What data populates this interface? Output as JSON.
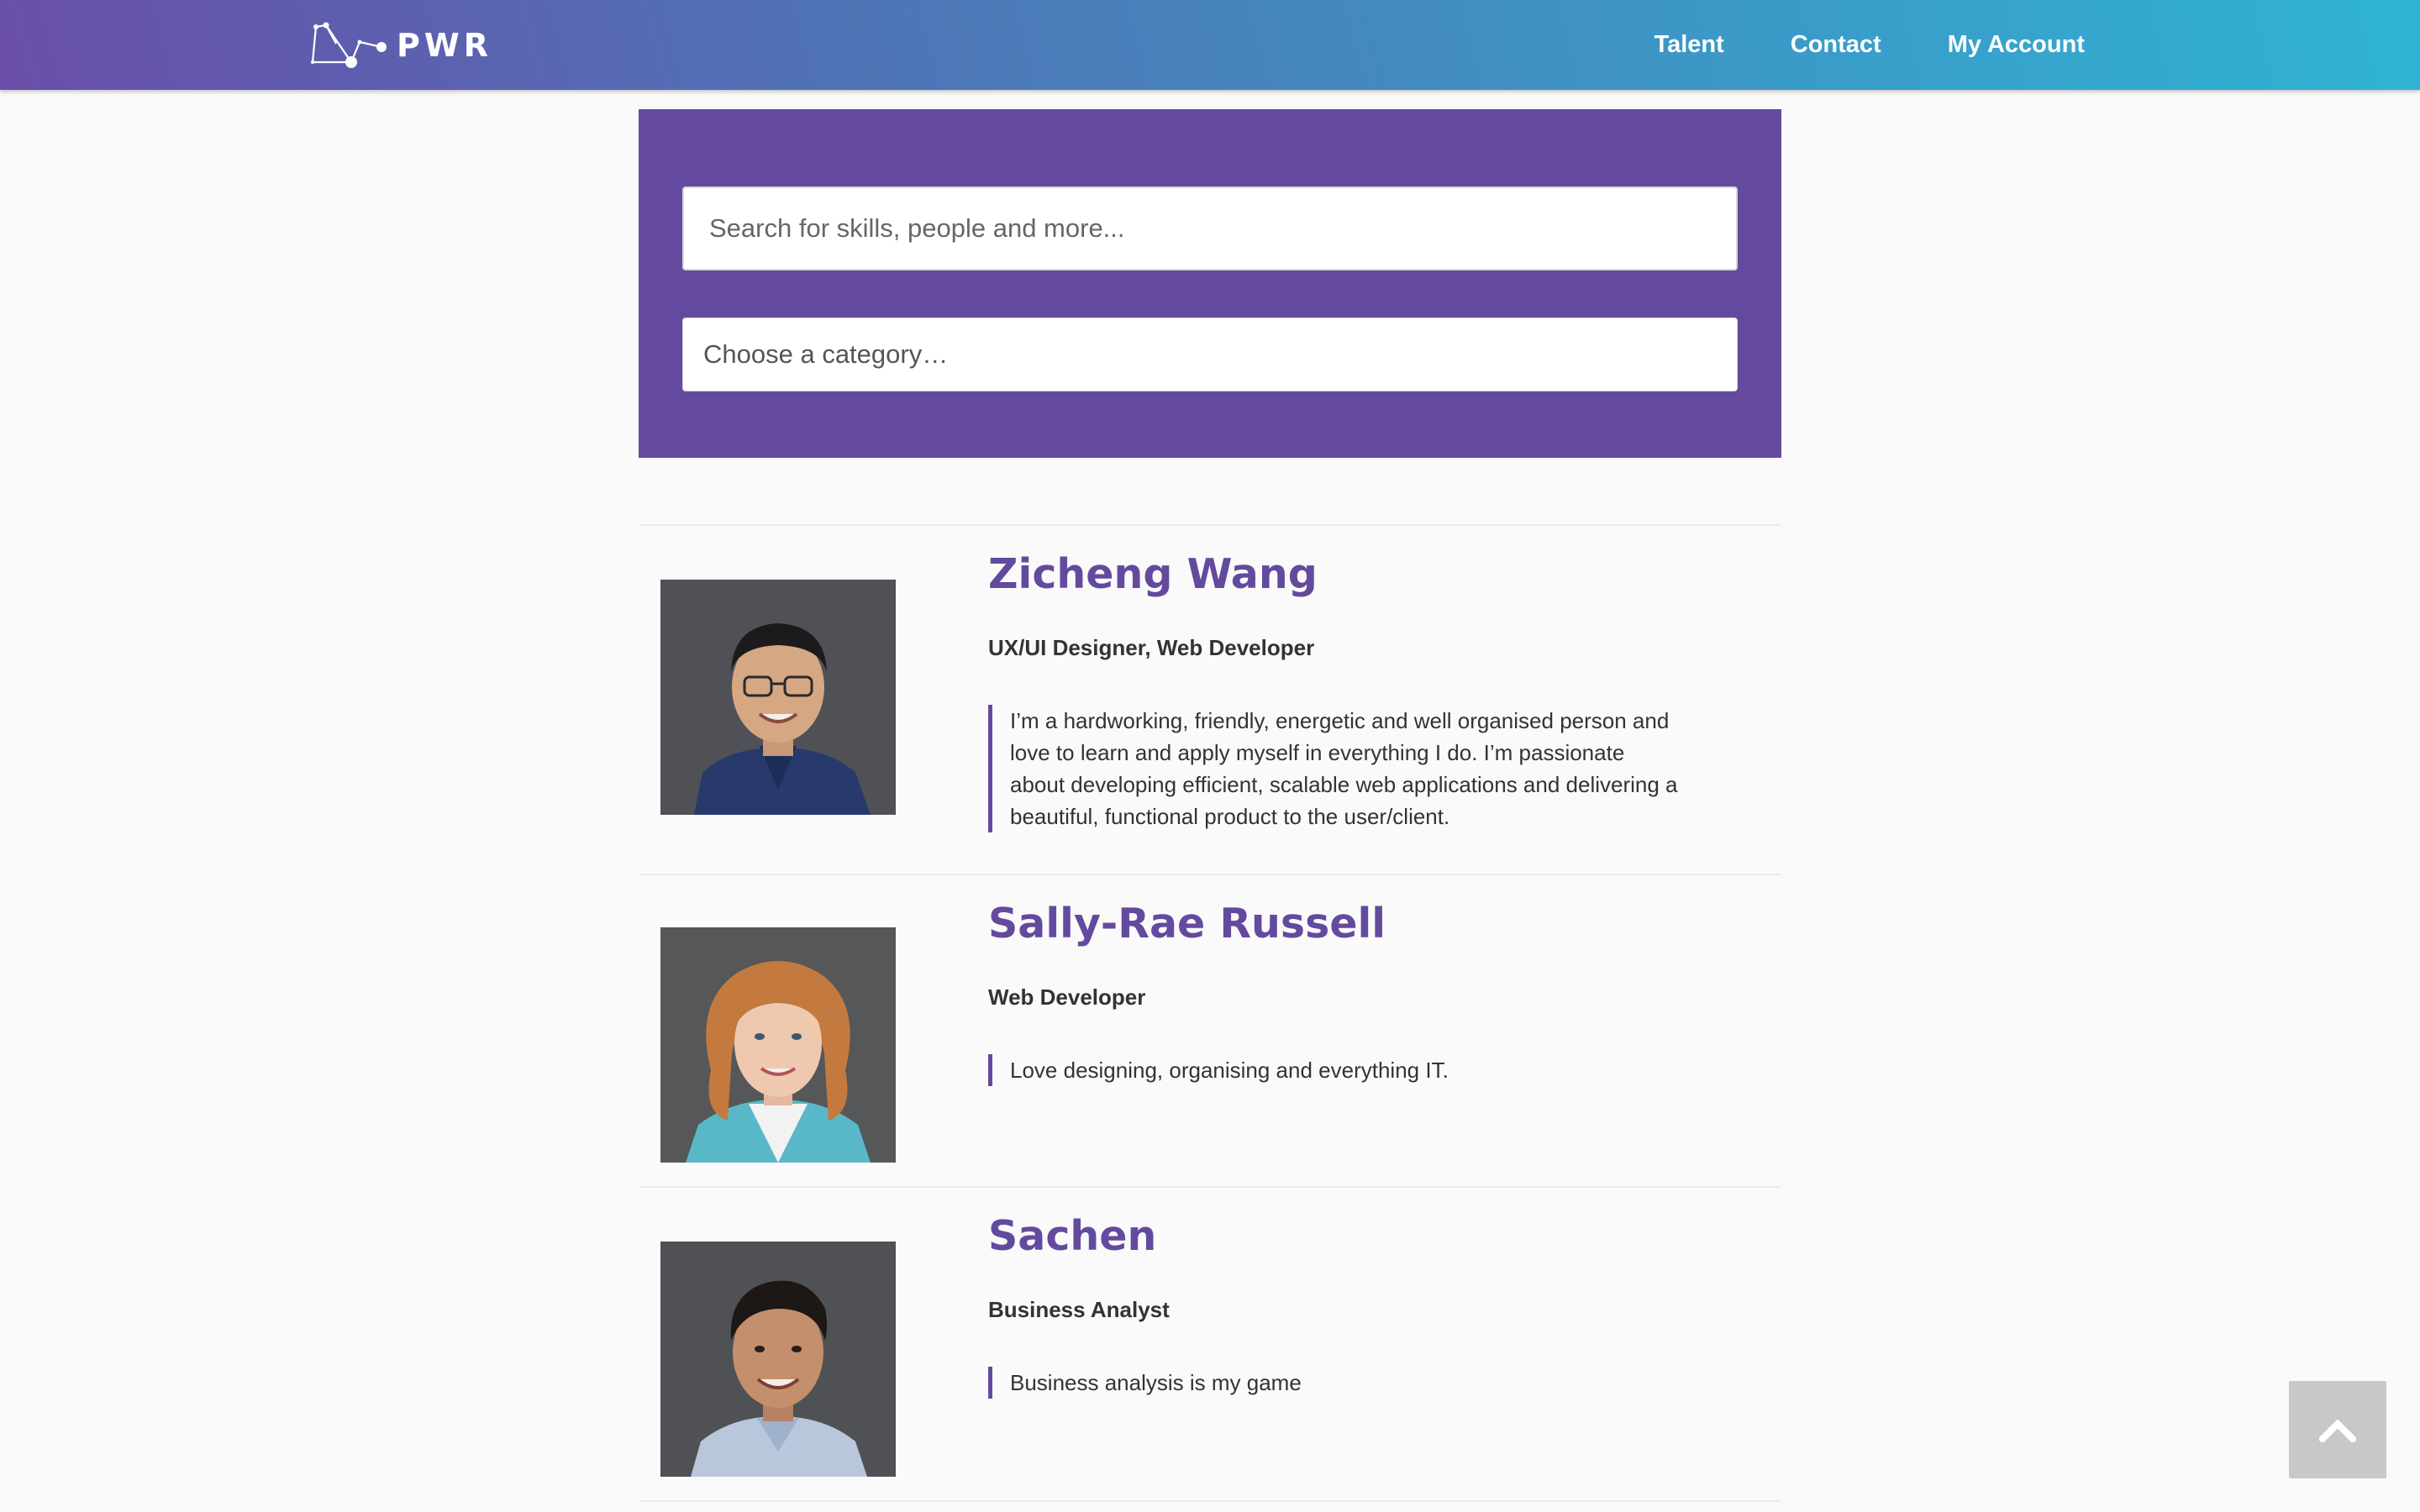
{
  "header": {
    "brand": "PWR",
    "logo_icon": "network-nodes-icon",
    "nav": [
      {
        "label": "Talent"
      },
      {
        "label": "Contact"
      },
      {
        "label": "My Account"
      }
    ]
  },
  "search": {
    "placeholder": "Search for skills, people and more...",
    "value": "",
    "category_placeholder": "Choose a category…"
  },
  "colors": {
    "brand_purple": "#644a9e",
    "header_gradient_start": "#6a4ea8",
    "header_gradient_end": "#2fb4d4"
  },
  "profiles": [
    {
      "name": "Zicheng Wang",
      "role": "UX/UI Designer, Web Developer",
      "bio": "I’m a hardworking, friendly, energetic and well organised person and love to learn and apply myself in everything I do. I’m passionate about developing efficient, scalable web applications and delivering a beautiful, functional product to the user/client."
    },
    {
      "name": "Sally-Rae Russell",
      "role": "Web Developer",
      "bio": "Love designing, organising and everything IT."
    },
    {
      "name": "Sachen",
      "role": "Business Analyst",
      "bio": "Business analysis is my game"
    }
  ],
  "back_to_top_icon": "chevron-up-icon"
}
